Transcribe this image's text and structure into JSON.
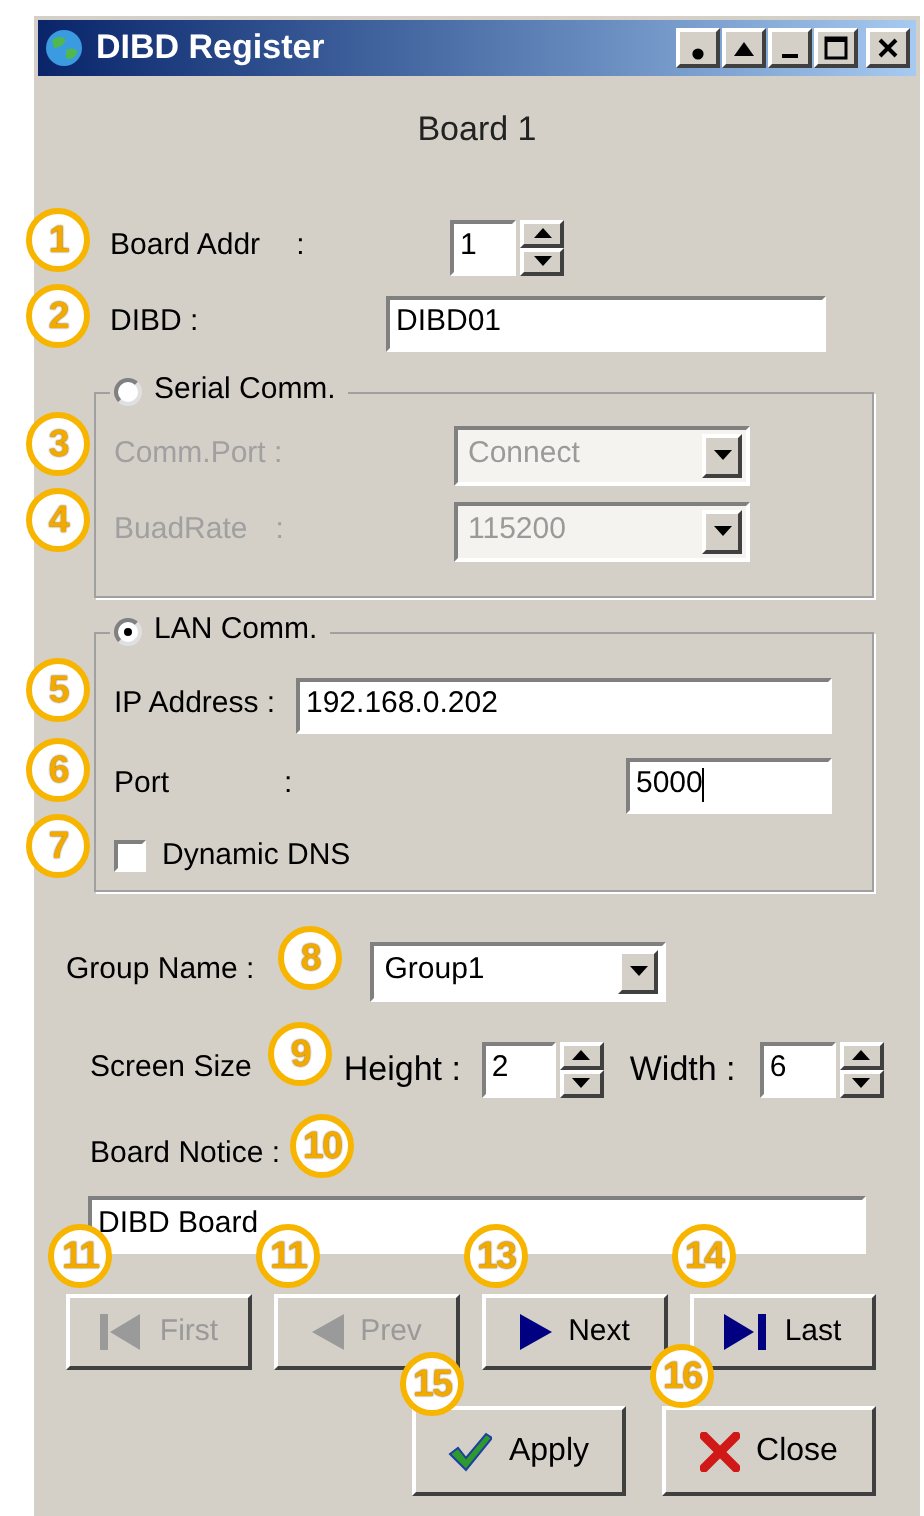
{
  "window": {
    "title": "DIBD Register"
  },
  "heading": "Board 1",
  "board_addr": {
    "label": "Board Addr",
    "sep": ":",
    "value": "1"
  },
  "dibd": {
    "label": "DIBD :",
    "value": "DIBD01"
  },
  "serial": {
    "label": "Serial Comm.",
    "selected": false,
    "comm_port": {
      "label": "Comm.Port :",
      "value": "Connect"
    },
    "baud_rate": {
      "label": "BuadRate",
      "sep": ":",
      "value": "115200"
    }
  },
  "lan": {
    "label": "LAN Comm.",
    "selected": true,
    "ip": {
      "label": "IP Address :",
      "value": "192.168.0.202"
    },
    "port": {
      "label": "Port",
      "sep": ":",
      "value": "5000"
    },
    "dynamic_dns": {
      "label": "Dynamic DNS",
      "checked": false
    }
  },
  "group_name": {
    "label": "Group Name :",
    "value": "Group1"
  },
  "screen_size": {
    "label": "Screen Size",
    "height": {
      "label": "Height :",
      "value": "2"
    },
    "width": {
      "label": "Width :",
      "value": "6"
    }
  },
  "board_notice": {
    "label": "Board Notice :",
    "value": "DIBD Board"
  },
  "nav_buttons": [
    {
      "kind": "first",
      "label": "First",
      "disabled": true
    },
    {
      "kind": "prev",
      "label": "Prev",
      "disabled": true
    },
    {
      "kind": "next",
      "label": "Next",
      "disabled": false
    },
    {
      "kind": "last",
      "label": "Last",
      "disabled": false
    }
  ],
  "action_buttons": [
    {
      "kind": "apply",
      "label": "Apply"
    },
    {
      "kind": "close",
      "label": "Close"
    }
  ],
  "callouts": [
    {
      "number": "1"
    },
    {
      "number": "2"
    },
    {
      "number": "3"
    },
    {
      "number": "4"
    },
    {
      "number": "5"
    },
    {
      "number": "6"
    },
    {
      "number": "7"
    },
    {
      "number": "8"
    },
    {
      "number": "9"
    },
    {
      "number": "10"
    },
    {
      "number": "11"
    },
    {
      "number": "11"
    },
    {
      "number": "13"
    },
    {
      "number": "14"
    },
    {
      "number": "15"
    },
    {
      "number": "16"
    }
  ]
}
